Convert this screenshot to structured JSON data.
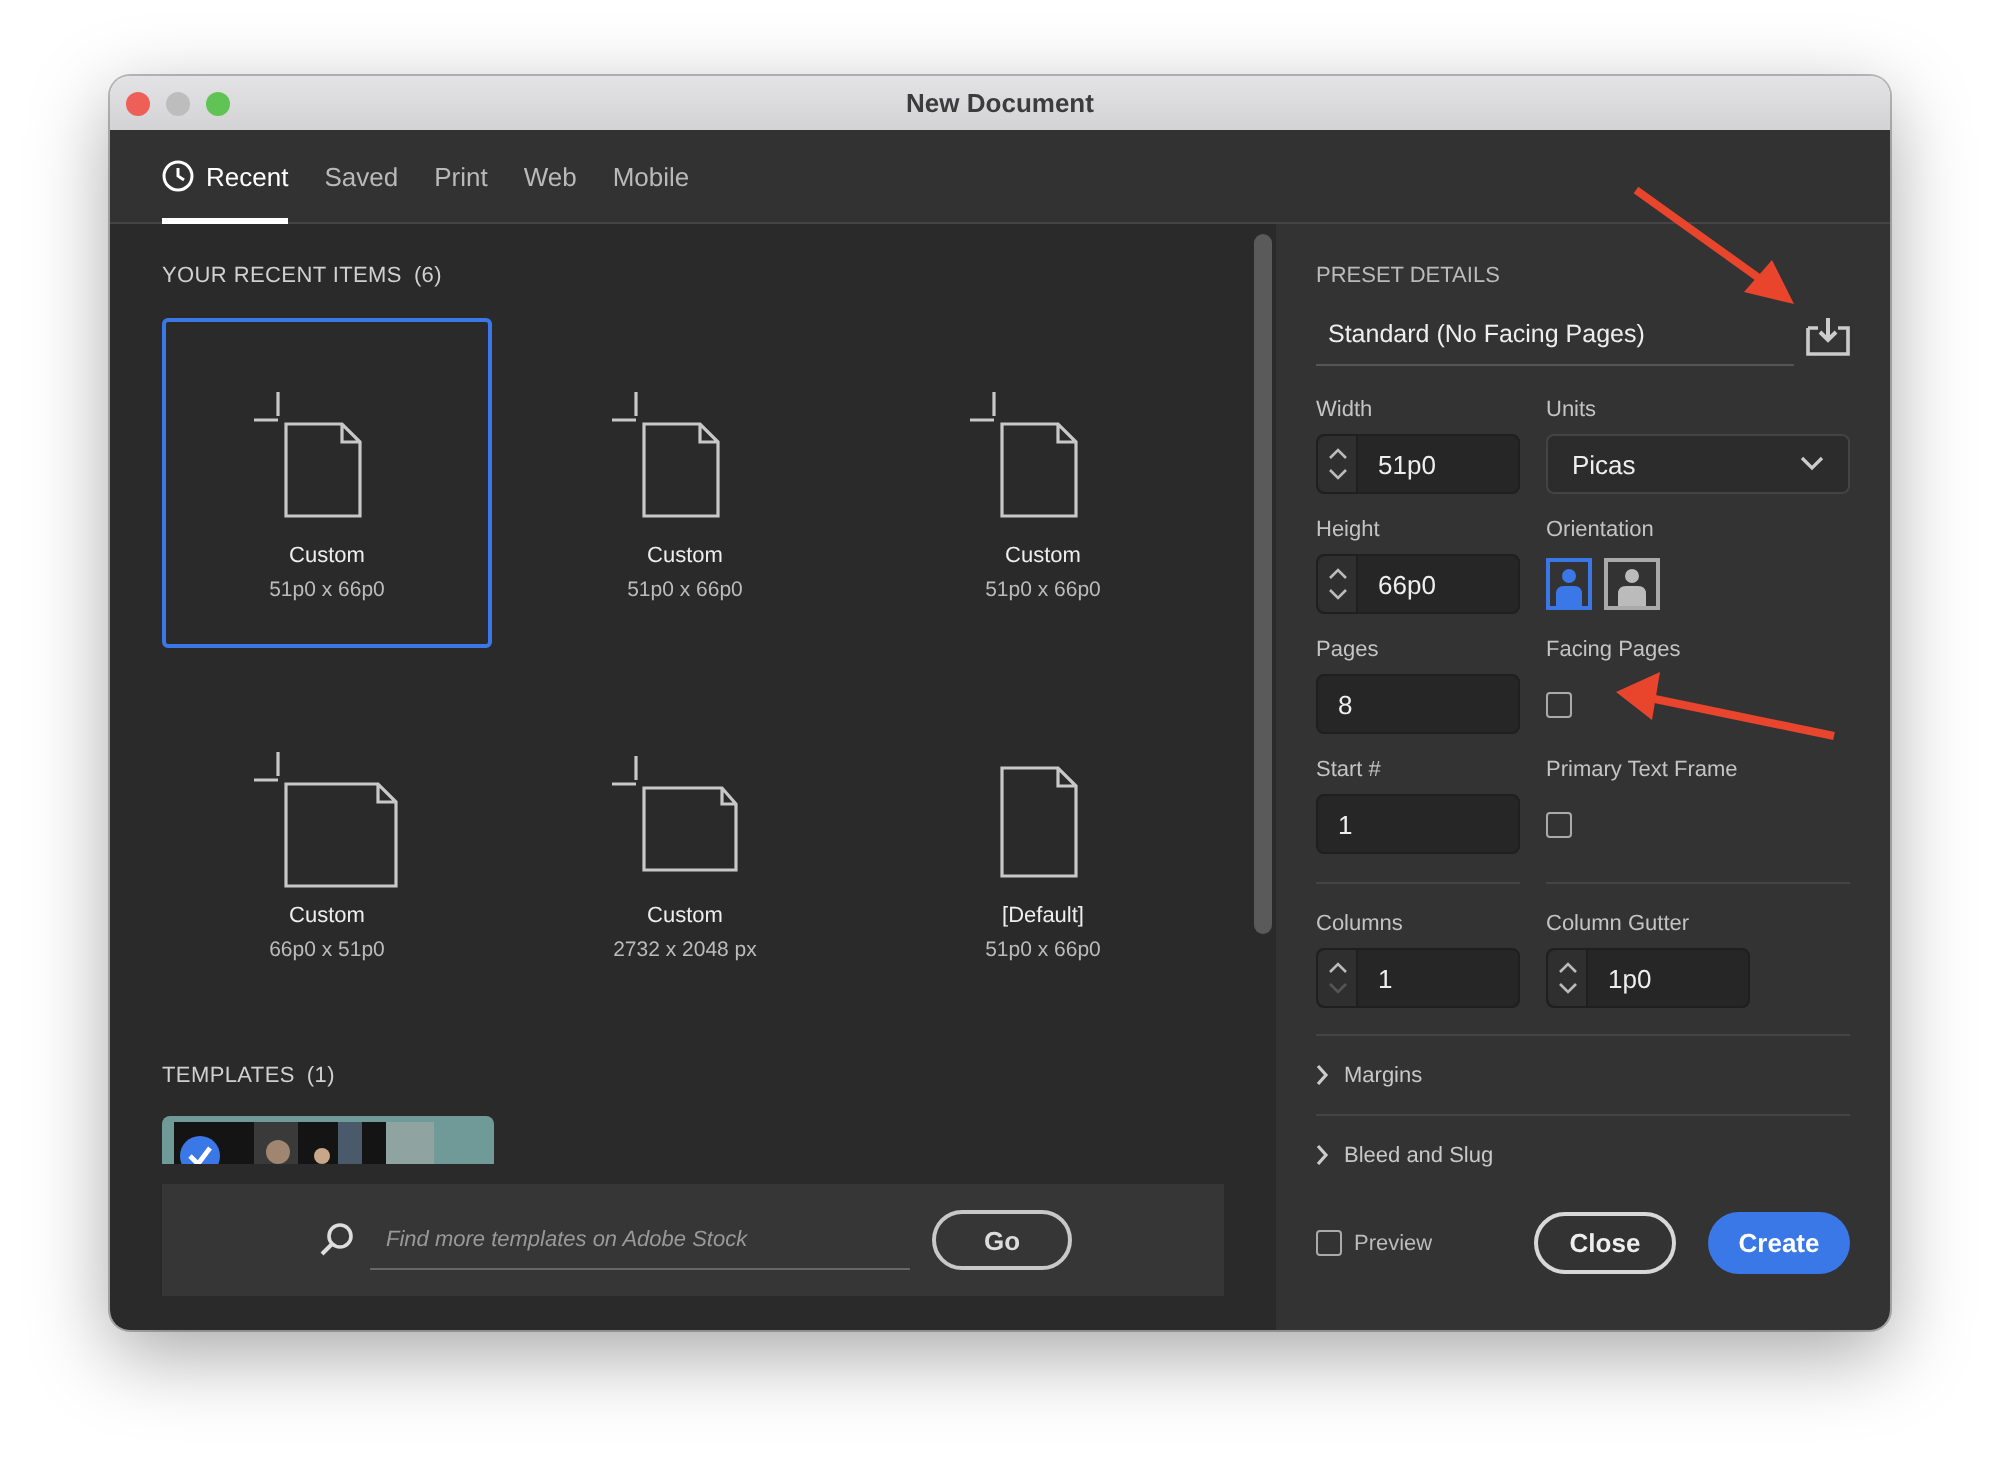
{
  "window": {
    "title": "New Document"
  },
  "tabs": [
    {
      "label": "Recent",
      "selected": true,
      "kind": "clock"
    },
    {
      "label": "Saved",
      "selected": false
    },
    {
      "label": "Print",
      "selected": false
    },
    {
      "label": "Web",
      "selected": false
    },
    {
      "label": "Mobile",
      "selected": false
    }
  ],
  "recent": {
    "heading": "YOUR RECENT ITEMS",
    "count": "(6)",
    "items": [
      {
        "name": "Custom",
        "size": "51p0 x 66p0",
        "kind": "portrait",
        "selected": true
      },
      {
        "name": "Custom",
        "size": "51p0 x 66p0",
        "kind": "portrait",
        "selected": false
      },
      {
        "name": "Custom",
        "size": "51p0 x 66p0",
        "kind": "portrait",
        "selected": false
      },
      {
        "name": "Custom",
        "size": "66p0 x 51p0",
        "kind": "landscape",
        "selected": false
      },
      {
        "name": "Custom",
        "size": "2732 x 2048 px",
        "kind": "wide",
        "selected": false
      },
      {
        "name": "[Default]",
        "size": "51p0 x 66p0",
        "kind": "plain",
        "selected": false
      }
    ]
  },
  "templates": {
    "heading": "TEMPLATES",
    "count": "(1)",
    "items": [
      {
        "kind": "picture",
        "checked": true
      }
    ]
  },
  "search": {
    "placeholder": "Find more templates on Adobe Stock",
    "button": "Go"
  },
  "preset": {
    "heading": "PRESET DETAILS",
    "name": "Standard (No Facing Pages)"
  },
  "fields": [
    {
      "label": "Width",
      "kind": "stepper",
      "value": "51p0",
      "down_disabled": false
    },
    {
      "label": "Units",
      "kind": "dropdown",
      "value": "Picas"
    },
    {
      "label": "Height",
      "kind": "stepper",
      "value": "66p0",
      "down_disabled": false
    },
    {
      "label": "Orientation",
      "kind": "orientation",
      "options": [
        {
          "kind": "portrait",
          "selected": true
        },
        {
          "kind": "landscape",
          "selected": false
        }
      ]
    },
    {
      "label": "Pages",
      "kind": "text",
      "value": "8"
    },
    {
      "label": "Facing Pages",
      "kind": "checkbox",
      "checked": false
    },
    {
      "label": "Start #",
      "kind": "text",
      "value": "1"
    },
    {
      "label": "Primary Text Frame",
      "kind": "checkbox",
      "checked": false
    },
    {
      "label": "Columns",
      "kind": "stepper",
      "value": "1",
      "down_disabled": true
    },
    {
      "label": "Column Gutter",
      "kind": "stepper",
      "value": "1p0",
      "down_disabled": false
    }
  ],
  "sections": [
    {
      "label": "Margins",
      "expanded": false
    },
    {
      "label": "Bleed and Slug",
      "expanded": false
    }
  ],
  "preview": {
    "label": "Preview",
    "checked": false
  },
  "buttons": [
    {
      "label": "Close",
      "kind": "secondary"
    },
    {
      "label": "Create",
      "kind": "primary"
    }
  ]
}
